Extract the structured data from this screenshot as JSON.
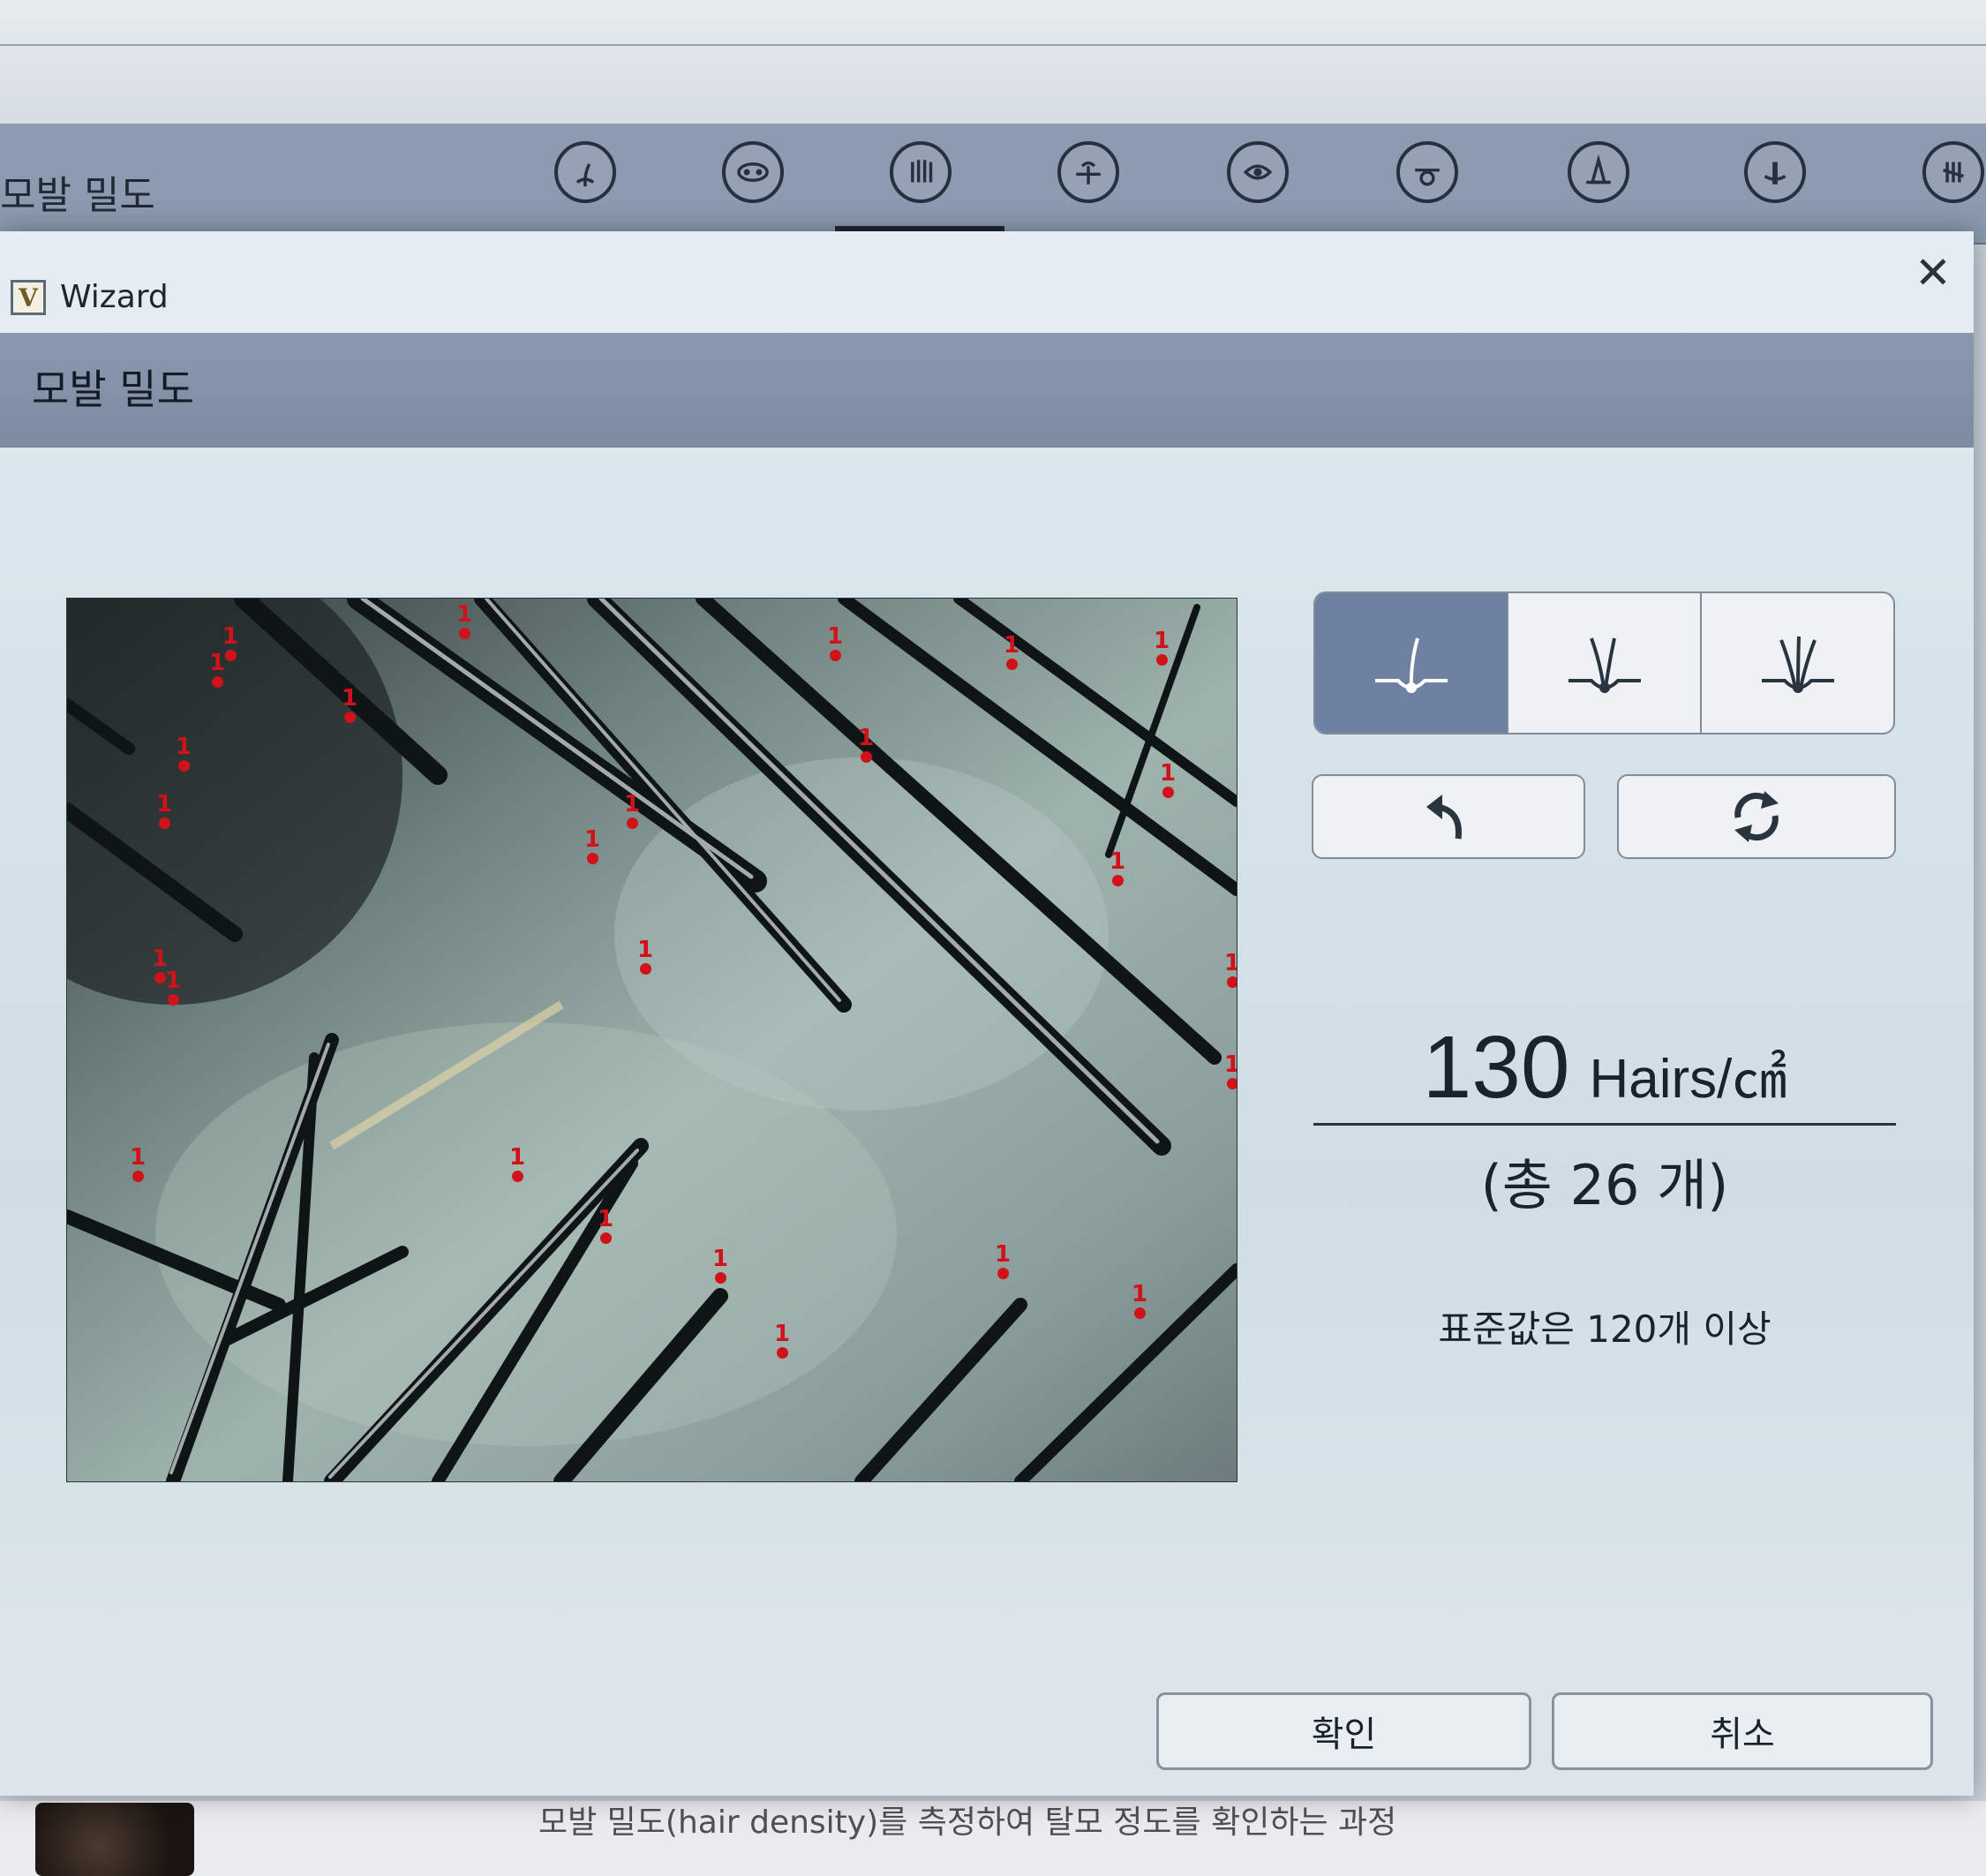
{
  "app": {
    "title": "모발 밀도",
    "toolbar_icons": [
      "hair-root-icon",
      "scalp-cells-icon",
      "hair-density-icon",
      "sebum-icon",
      "scalp-pores-icon",
      "follicle-icon",
      "keratin-icon",
      "hair-thickness-icon",
      "hair-loss-icon"
    ],
    "active_tool_index": 2,
    "bottom_text": "모발 밀도(hair density)를 측정하여 탈모 정도를 확인하는 과정"
  },
  "dialog": {
    "window_title": "Wizard",
    "heading": "모발 밀도",
    "close_symbol": "✕",
    "mode_buttons": [
      "single-hair-icon",
      "double-hair-icon",
      "triple-hair-icon"
    ],
    "active_mode": 0,
    "undo_icon": "undo-icon",
    "reset_icon": "refresh-icon",
    "density_value": "130",
    "density_unit": "Hairs/㎠",
    "total_count_text": "(총 26 개)",
    "standard_note": "표준값은 120개 이상",
    "confirm_label": "확인",
    "cancel_label": "취소",
    "marker_label": "1",
    "marker_color": "#d0121a",
    "accent_color": "#6e81a0"
  }
}
